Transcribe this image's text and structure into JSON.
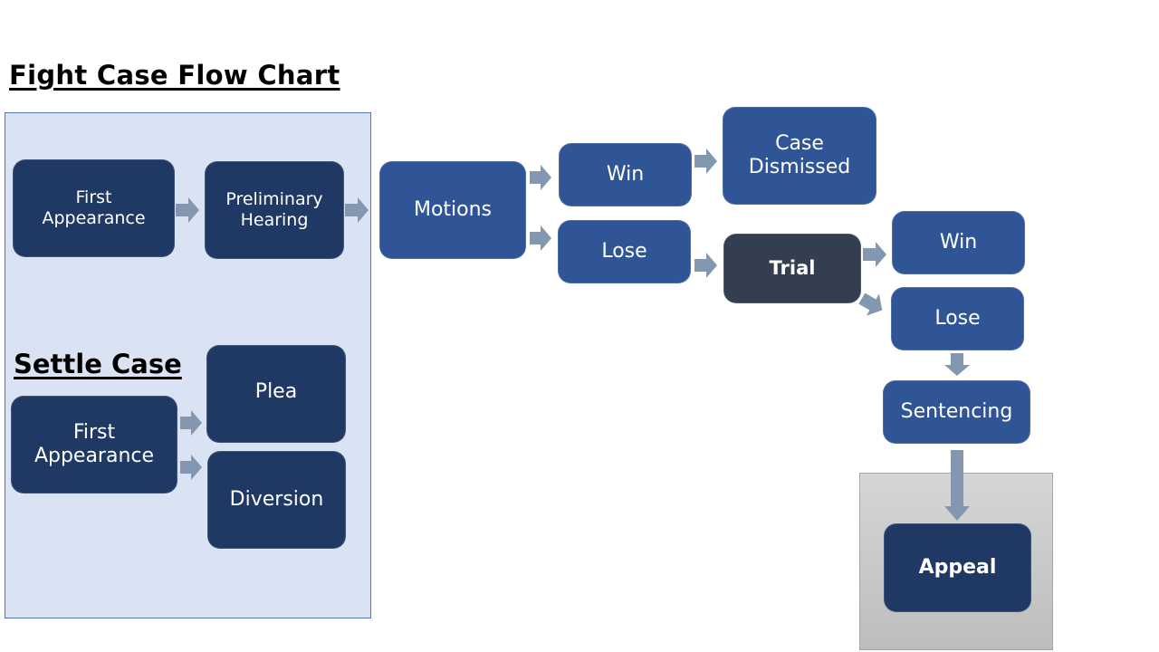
{
  "title": "Fight Case Flow Chart",
  "settle_title": "Settle Case",
  "colors": {
    "panel_bg": "#dae3f3",
    "dark_box": "#203864",
    "mid_box": "#2f5597",
    "trial_box": "#333f50",
    "arrow": "#8497b0",
    "gray_panel": "#c9c9c9"
  },
  "nodes": {
    "fight_first_appearance": "First Appearance",
    "preliminary_hearing": "Preliminary Hearing",
    "motions": "Motions",
    "motions_win": "Win",
    "motions_lose": "Lose",
    "case_dismissed": "Case Dismissed",
    "trial": "Trial",
    "trial_win": "Win",
    "trial_lose": "Lose",
    "sentencing": "Sentencing",
    "appeal": "Appeal",
    "settle_first_appearance": "First Appearance",
    "plea": "Plea",
    "diversion": "Diversion"
  },
  "edges": [
    [
      "fight_first_appearance",
      "preliminary_hearing"
    ],
    [
      "preliminary_hearing",
      "motions"
    ],
    [
      "motions",
      "motions_win"
    ],
    [
      "motions",
      "motions_lose"
    ],
    [
      "motions_win",
      "case_dismissed"
    ],
    [
      "motions_lose",
      "trial"
    ],
    [
      "trial",
      "trial_win"
    ],
    [
      "trial",
      "trial_lose"
    ],
    [
      "trial_lose",
      "sentencing"
    ],
    [
      "sentencing",
      "appeal"
    ],
    [
      "settle_first_appearance",
      "plea"
    ],
    [
      "settle_first_appearance",
      "diversion"
    ]
  ]
}
